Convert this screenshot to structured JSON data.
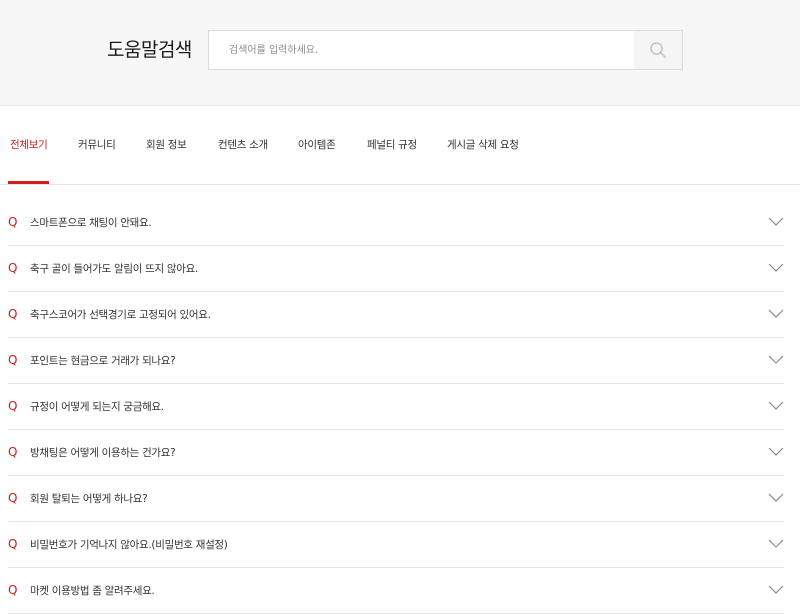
{
  "header": {
    "title": "도움말검색",
    "search": {
      "placeholder": "검색어를 입력하세요.",
      "value": "",
      "button_icon": "search-icon"
    }
  },
  "tabs": [
    {
      "label": "전체보기",
      "active": true
    },
    {
      "label": "커뮤니티",
      "active": false
    },
    {
      "label": "회원 정보",
      "active": false
    },
    {
      "label": "컨텐츠 소개",
      "active": false
    },
    {
      "label": "아이템존",
      "active": false
    },
    {
      "label": "페널티 규정",
      "active": false
    },
    {
      "label": "게시글 삭제 요청",
      "active": false
    }
  ],
  "faq": {
    "marker": "Q",
    "expand_icon": "chevron-down-icon",
    "items": [
      {
        "question": "스마트폰으로 채팅이 안돼요."
      },
      {
        "question": "축구 골이 들어가도 알림이 뜨지 않아요."
      },
      {
        "question": "축구스코어가 선택경기로 고정되어 있어요."
      },
      {
        "question": "포인트는 현금으로 거래가 되나요?"
      },
      {
        "question": "규정이 어떻게 되는지 궁금해요."
      },
      {
        "question": "방채팅은 어떻게 이용하는 건가요?"
      },
      {
        "question": "회원 탈퇴는 어떻게 하나요?"
      },
      {
        "question": "비밀번호가 기억나지 않아요.(비밀번호 재설정)"
      },
      {
        "question": "마켓 이용방법 좀 알려주세요."
      }
    ]
  },
  "colors": {
    "accent": "#c81e1e",
    "header_bg": "#f7f7f7",
    "divider": "#e6e6e6"
  }
}
